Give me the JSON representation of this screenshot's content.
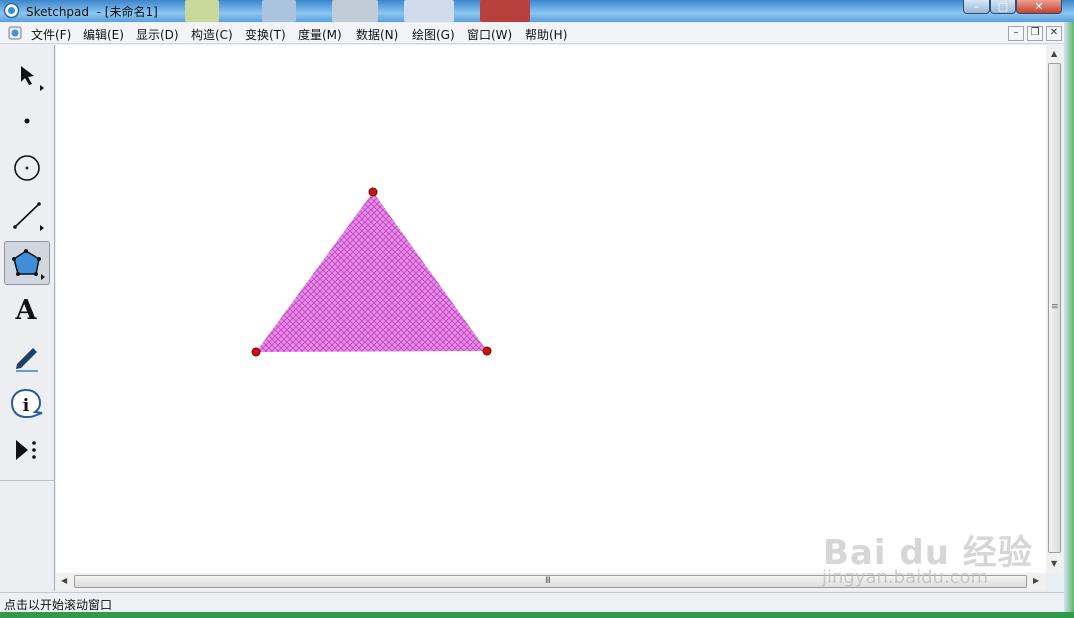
{
  "window": {
    "title": "Sketchpad  - [未命名1]",
    "controls": {
      "minimize": "–",
      "maximize": "□",
      "close": "✕"
    }
  },
  "menu": {
    "items": [
      {
        "label": "文件(F)"
      },
      {
        "label": "编辑(E)"
      },
      {
        "label": "显示(D)"
      },
      {
        "label": "构造(C)"
      },
      {
        "label": "变换(T)"
      },
      {
        "label": "度量(M)"
      },
      {
        "label": "数据(N)"
      },
      {
        "label": "绘图(G)"
      },
      {
        "label": "窗口(W)"
      },
      {
        "label": "帮助(H)"
      }
    ],
    "mdi_controls": {
      "minimize": "–",
      "restore": "❐",
      "close": "✕"
    }
  },
  "toolbox": {
    "tools": [
      {
        "icon": "arrow-select-icon"
      },
      {
        "icon": "point-icon"
      },
      {
        "icon": "compass-icon"
      },
      {
        "icon": "straightedge-icon"
      },
      {
        "icon": "polygon-icon",
        "active": true
      },
      {
        "icon": "text-icon",
        "glyph": "A"
      },
      {
        "icon": "marker-icon"
      },
      {
        "icon": "information-icon",
        "glyph": "i"
      },
      {
        "icon": "custom-tool-icon"
      }
    ]
  },
  "canvas": {
    "polygon": {
      "fill": "#e67ce6",
      "hatch": "#c05ac0",
      "vertex_color": "#d01010"
    }
  },
  "scrollbars": {
    "horizontal_grip": "III",
    "vertical_grip": "≡"
  },
  "status": {
    "text": "点击以开始滚动窗口"
  },
  "watermark": {
    "brand": "Bai  du 经验",
    "url": "jingyan.baidu.com"
  }
}
